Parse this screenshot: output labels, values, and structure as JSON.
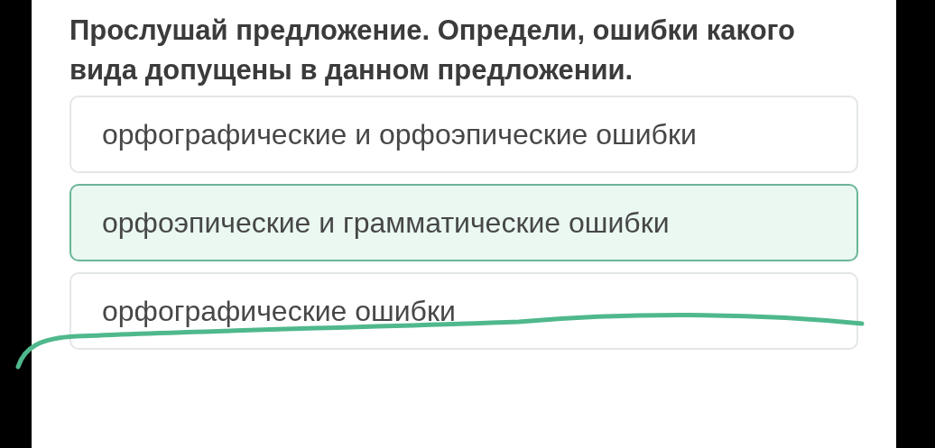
{
  "question": "Прослушай предложение. Определи, ошибки какого вида допущены в данном предложении.",
  "options": [
    {
      "label": "орфографические и орфоэпические ошибки",
      "selected": false
    },
    {
      "label": "орфоэпические и грамматические ошибки",
      "selected": true
    },
    {
      "label": "орфографические ошибки",
      "selected": false
    }
  ]
}
